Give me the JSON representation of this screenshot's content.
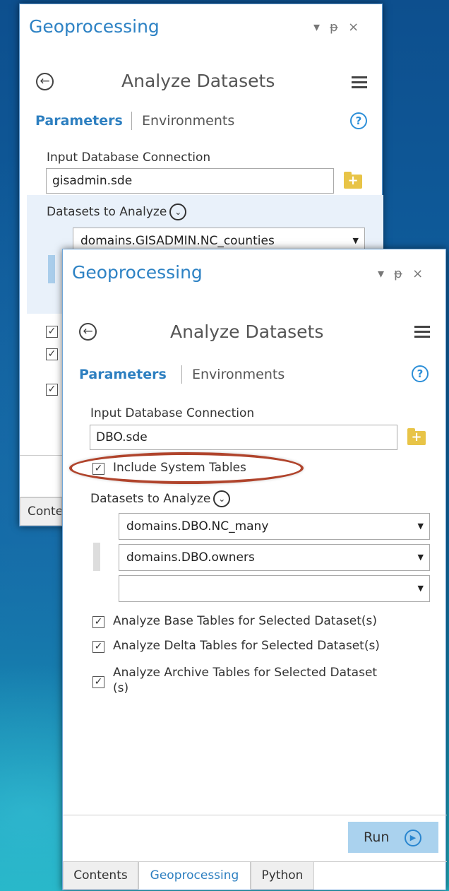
{
  "back_panel": {
    "title": "Geoprocessing",
    "controls": {
      "dropdown": "▾",
      "pin": "ᵽ",
      "close": "×"
    },
    "tool_name": "Analyze Datasets",
    "tabs": {
      "parameters": "Parameters",
      "environments": "Environments"
    },
    "input_label": "Input Database Connection",
    "input_value": "gisadmin.sde",
    "datasets_label": "Datasets to Analyze",
    "dataset_1": "domains.GISADMIN.NC_counties",
    "bottom_tab_partial": "Conte"
  },
  "front_panel": {
    "title": "Geoprocessing",
    "controls": {
      "dropdown": "▾",
      "pin": "ᵽ",
      "close": "×"
    },
    "tool_name": "Analyze Datasets",
    "tabs": {
      "parameters": "Parameters",
      "environments": "Environments"
    },
    "input_label": "Input Database Connection",
    "input_value": "DBO.sde",
    "include_system_tables": {
      "label": "Include System Tables",
      "checked": true
    },
    "datasets_label": "Datasets to Analyze",
    "datasets": [
      "domains.DBO.NC_many",
      "domains.DBO.owners",
      ""
    ],
    "options": [
      {
        "label": "Analyze Base Tables for Selected Dataset(s)",
        "checked": true
      },
      {
        "label": "Analyze Delta Tables for Selected Dataset(s)",
        "checked": true
      },
      {
        "label_line1": "Analyze Archive Tables for Selected Dataset",
        "label_line2": "(s)",
        "checked": true
      }
    ],
    "run_label": "Run",
    "bottom_tabs": [
      "Contents",
      "Geoprocessing",
      "Python"
    ],
    "active_tab": "Geoprocessing"
  },
  "icons": {
    "back": "back-arrow-icon",
    "menu": "hamburger-menu-icon",
    "help": "help-icon",
    "folder": "add-folder-icon",
    "chevron": "chevron-down-circle-icon",
    "run": "play-icon"
  },
  "colors": {
    "accent": "#2d82c4",
    "highlight": "#b0442c",
    "run_button": "#aad2ee"
  }
}
